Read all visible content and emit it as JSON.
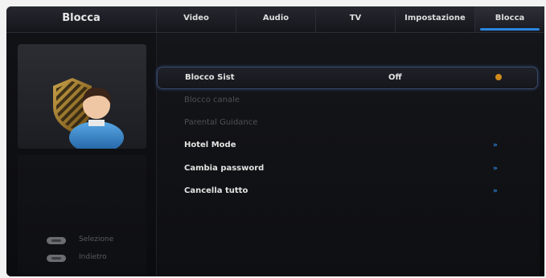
{
  "header": {
    "title": "Blocca",
    "tabs": [
      {
        "label": "Video"
      },
      {
        "label": "Audio"
      },
      {
        "label": "TV"
      },
      {
        "label": "Impostazione"
      },
      {
        "label": "Blocca"
      }
    ],
    "active_tab_index": 4
  },
  "left_panel": {
    "icon": "lock-user-icon",
    "hints": [
      {
        "icon": "ok-remote-button-icon",
        "label": "Selezione"
      },
      {
        "icon": "menu-remote-button-icon",
        "label": "Indietro"
      }
    ]
  },
  "menu": {
    "items": [
      {
        "label": "Blocco Sist",
        "value": "Off",
        "state": "selected"
      },
      {
        "label": "Blocco canale",
        "state": "disabled"
      },
      {
        "label": "Parental Guidance",
        "state": "disabled"
      },
      {
        "label": "Hotel Mode",
        "state": "enabled"
      },
      {
        "label": "Cambia password",
        "state": "enabled"
      },
      {
        "label": "Cancella tutto",
        "state": "enabled"
      }
    ]
  },
  "colors": {
    "accent": "#2a86e0",
    "arrow": "#2f8be6",
    "info_dot": "#d08a1b",
    "background": "#0d0e12"
  }
}
